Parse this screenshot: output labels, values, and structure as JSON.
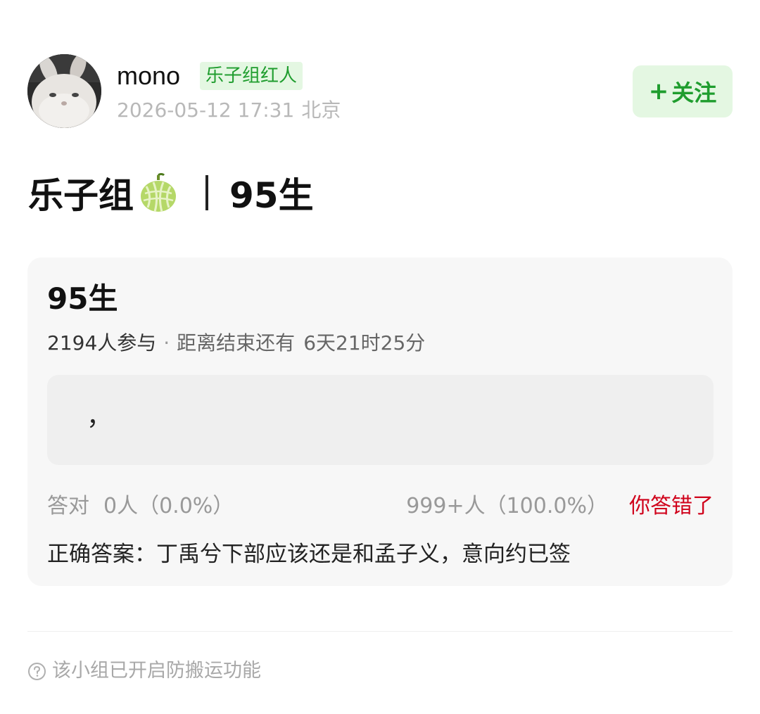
{
  "author": {
    "name": "mono",
    "badge": "乐子组红人",
    "timestamp": "2026-05-12 17:31",
    "location": "北京",
    "follow_plus": "+",
    "follow_label": "关注"
  },
  "post": {
    "title_prefix": "乐子组",
    "title_suffix": "95生"
  },
  "quiz": {
    "title": "95生",
    "participants": "2194人参与",
    "separator": "·",
    "countdown_label": "距离结束还有",
    "countdown_value": "6天21时25分",
    "answer_text": "，",
    "correct_label": "答对",
    "correct_count": "0人（0.0%）",
    "wrong_count": "999+人（100.0%）",
    "wrong_label": "你答错了",
    "correct_answer": "正确答案：丁禹兮下部应该还是和孟子义，意向约已签"
  },
  "footer": {
    "note": "该小组已开启防搬运功能"
  },
  "colors": {
    "accent_green": "#1f9d2e",
    "badge_bg": "#e4f7e2",
    "error_red": "#d0021b"
  },
  "icons": {
    "melon": "melon-icon",
    "help": "question-circle-icon"
  }
}
